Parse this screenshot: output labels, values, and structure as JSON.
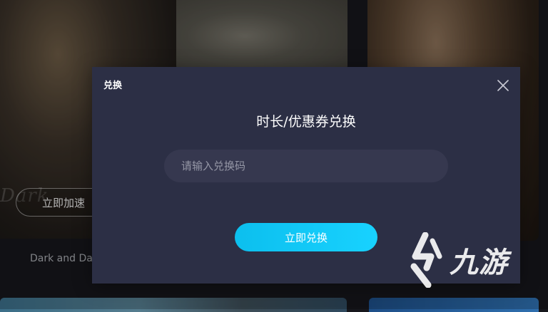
{
  "background": {
    "card_button_label": "立即加速",
    "card_faint_title": "Dark",
    "game_title": "Dark and Da"
  },
  "modal": {
    "title": "兑换",
    "heading": "时长/优惠券兑换",
    "input": {
      "placeholder": "请输入兑换码",
      "value": ""
    },
    "submit_label": "立即兑换",
    "close_icon": "close-icon"
  },
  "watermark": {
    "text": "九游",
    "logo_icon": "jiuyou-logo-icon"
  },
  "colors": {
    "modal_bg": "#2c2f45",
    "input_bg": "#36384f",
    "accent_gradient_start": "#0cbfee",
    "accent_gradient_end": "#18d2ff",
    "page_bg": "#16171c"
  }
}
